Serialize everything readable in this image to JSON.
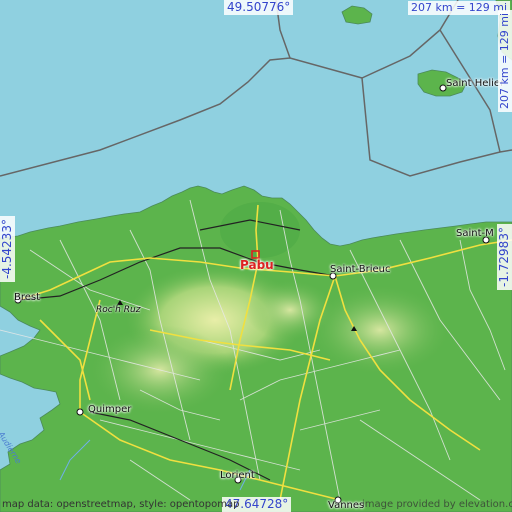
{
  "map": {
    "place_name": "Pabu",
    "marker_color": "#dd2222",
    "cities": [
      {
        "name": "Saint-Brieuc",
        "type": "city"
      },
      {
        "name": "Brest",
        "type": "city"
      },
      {
        "name": "Quimper",
        "type": "city"
      },
      {
        "name": "Lorient",
        "type": "city"
      },
      {
        "name": "Vannes",
        "type": "city"
      },
      {
        "name": "Saint Helier",
        "type": "city"
      },
      {
        "name": "Saint-M",
        "type": "city"
      },
      {
        "name": "Roc'h Ruz",
        "type": "peak"
      }
    ],
    "water_label": "Audierne",
    "coords": {
      "top": "49.50776°",
      "bottom": "47.64728°",
      "left": "-4.54233°",
      "right": "-1.72983°"
    },
    "scale_top": "207 km = 129 mi",
    "scale_right": "207 km = 129 mi",
    "attribution_left": "map data: openstreetmap, style: opentopomap",
    "attribution_right": "image provided by elevation.city",
    "colors": {
      "sea": "#8fd0e0",
      "lowland": "#55b04a",
      "upland": "#c8e090",
      "roads_major": "#f0e040",
      "border": "#666666"
    }
  }
}
